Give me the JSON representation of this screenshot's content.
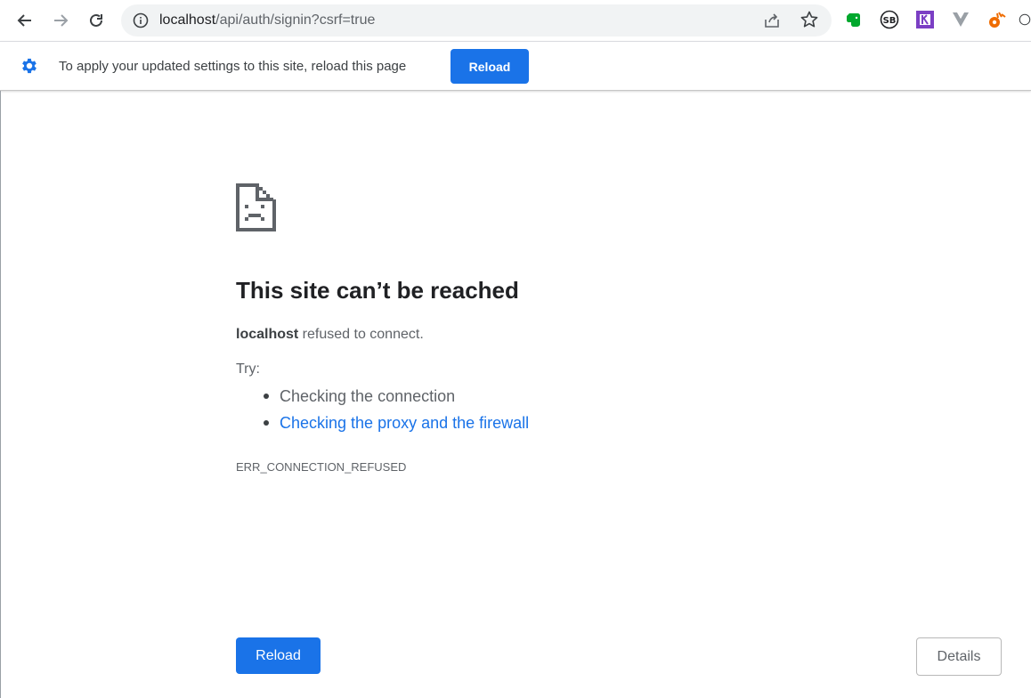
{
  "browser": {
    "url_host": "localhost",
    "url_path": "/api/auth/signin?csrf=true",
    "icons": {
      "back": "arrow-left-icon",
      "forward": "arrow-right-icon",
      "refresh": "reload-icon",
      "site_info": "info-icon",
      "share": "share-icon",
      "bookmark": "star-icon"
    },
    "extensions": [
      {
        "name": "evernote-extension-icon",
        "label": ""
      },
      {
        "name": "sb-extension-icon",
        "label": "SB"
      },
      {
        "name": "purple-extension-icon",
        "label": ""
      },
      {
        "name": "vue-devtools-extension-icon",
        "label": ""
      },
      {
        "name": "orange-extension-icon",
        "label": ""
      }
    ]
  },
  "infobar": {
    "icon": "gear-icon",
    "message": "To apply your updated settings to this site, reload this page",
    "button_label": "Reload"
  },
  "error": {
    "icon": "sad-page-icon",
    "title": "This site can’t be reached",
    "host": "localhost",
    "refused_text": " refused to connect.",
    "try_label": "Try:",
    "suggestions": [
      {
        "text": "Checking the connection",
        "is_link": false
      },
      {
        "text": "Checking the proxy and the firewall",
        "is_link": true
      }
    ],
    "code": "ERR_CONNECTION_REFUSED",
    "reload_label": "Reload",
    "details_label": "Details"
  },
  "colors": {
    "accent": "#1a73e8",
    "text_primary": "#202124",
    "text_secondary": "#5f6368"
  }
}
